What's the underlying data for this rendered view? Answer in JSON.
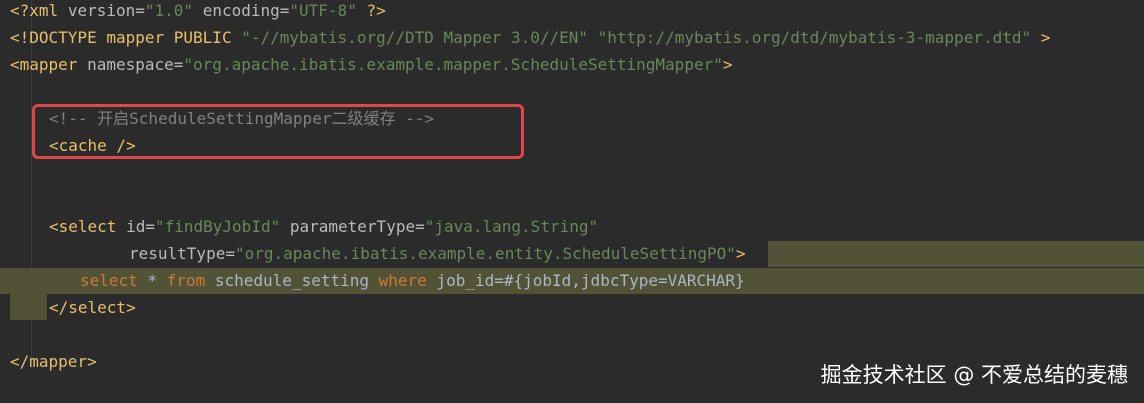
{
  "editor": {
    "lines": {
      "l1": {
        "decl_open": "<?xml",
        "version_attr": "version=",
        "version_val": "\"1.0\"",
        "encoding_attr": "encoding=",
        "encoding_val": "\"UTF-8\"",
        "decl_close": "?>"
      },
      "l2": {
        "doctype_open": "<!DOCTYPE",
        "doctype_text": "mapper PUBLIC",
        "public_id": "\"-//mybatis.org//DTD Mapper 3.0//EN\"",
        "system_id": "\"http://mybatis.org/dtd/mybatis-3-mapper.dtd\"",
        "doctype_close": ">"
      },
      "l3": {
        "tag_open": "<mapper",
        "ns_attr": "namespace=",
        "ns_val": "\"org.apache.ibatis.example.mapper.ScheduleSettingMapper\"",
        "tag_close": ">"
      },
      "l5": {
        "comment": "<!-- 开启ScheduleSettingMapper二级缓存 -->"
      },
      "l6": {
        "cache_tag": "<cache />"
      },
      "l9": {
        "tag_open": "<select",
        "id_attr": "id=",
        "id_val": "\"findByJobId\"",
        "param_attr": "parameterType=",
        "param_val": "\"java.lang.String\""
      },
      "l10": {
        "result_attr": "resultType=",
        "result_val": "\"org.apache.ibatis.example.entity.ScheduleSettingPO\"",
        "tag_close": ">"
      },
      "l11": {
        "kw_select": "select",
        "star": " * ",
        "kw_from": "from",
        "table": " schedule_setting ",
        "kw_where": "where",
        "condition": " job_id=#{jobId,jdbcType=VARCHAR}"
      },
      "l12": {
        "close_select": "</select>"
      },
      "l14": {
        "close_mapper": "</mapper>"
      }
    }
  },
  "watermark": {
    "text": "掘金技术社区 @ 不爱总结的麦穗"
  }
}
